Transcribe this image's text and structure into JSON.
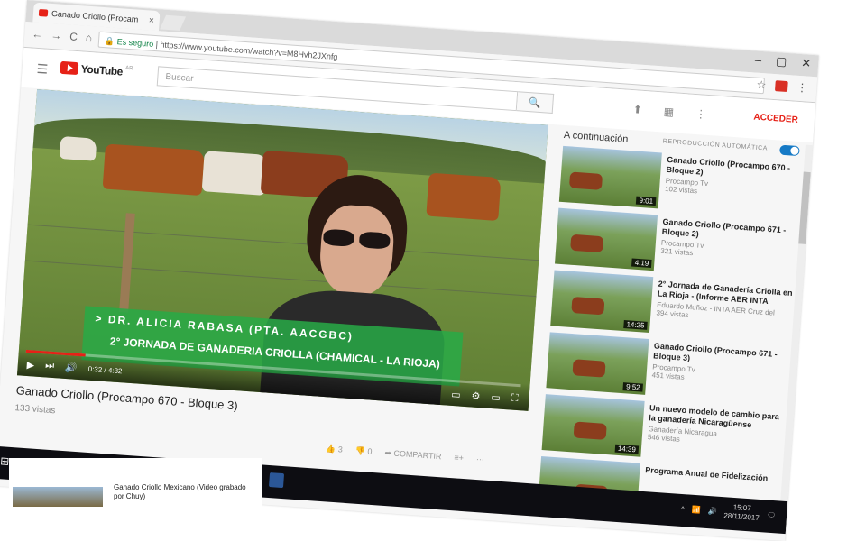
{
  "browser": {
    "tab_title": "Ganado Criollo (Procam",
    "tab_close": "×",
    "secure_label": "Es seguro",
    "url": "https://www.youtube.com/watch?v=M8Hvh2JXnfg",
    "win_controls": [
      "–",
      "▢",
      "✕"
    ]
  },
  "youtube": {
    "logo_text": "YouTube",
    "logo_country": "AR",
    "search_placeholder": "Buscar",
    "signin_label": "ACCEDER"
  },
  "video": {
    "overlay_name": "> DR. ALICIA RABASA (PTA. AACGBC)",
    "overlay_subtitle": "2° JORNADA DE GANADERIA CRIOLLA (CHAMICAL - LA RIOJA)",
    "time": "0:32 / 4:32",
    "progress": 0.12,
    "title": "Ganado Criollo (Procampo 670 - Bloque 3)",
    "views": "133 vistas",
    "likes": "3",
    "dislikes": "0",
    "share_label": "COMPARTIR"
  },
  "sidebar": {
    "up_next": "A continuación",
    "autoplay": "REPRODUCCIÓN AUTOMÁTICA",
    "items": [
      {
        "title": "Ganado Criollo (Procampo 670 - Bloque 2)",
        "channel": "Procampo Tv",
        "views": "102 vistas",
        "duration": "9:01"
      },
      {
        "title": "Ganado Criollo (Procampo 671 - Bloque 2)",
        "channel": "Procampo Tv",
        "views": "321 vistas",
        "duration": "4:19"
      },
      {
        "title": "2° Jornada de Ganadería Criolla en La Rioja - (Informe AER INTA",
        "channel": "Eduardo Muñoz - INTA AER Cruz del",
        "views": "394 vistas",
        "duration": "14:25"
      },
      {
        "title": "Ganado Criollo (Procampo 671 - Bloque 3)",
        "channel": "Procampo Tv",
        "views": "451 vistas",
        "duration": "9:52"
      },
      {
        "title": "Un nuevo modelo de cambio para la ganadería Nicaragüense",
        "channel": "Ganadería Nicaragua",
        "views": "546 vistas",
        "duration": "14:39"
      },
      {
        "title": "Programa Anual de Fidelización",
        "channel": "",
        "views": "",
        "duration": ""
      }
    ]
  },
  "taskbar": {
    "time": "15:07",
    "date": "28/11/2017"
  },
  "background_card": {
    "title": "Ganado Criollo Mexicano (Video grabado por Chuy)"
  }
}
